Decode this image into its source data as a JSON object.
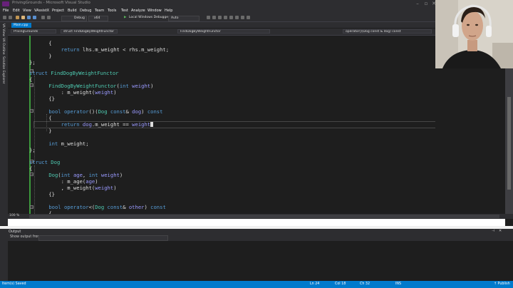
{
  "window": {
    "title": "PrivingGrounds - Microsoft Visual Studio"
  },
  "menu": [
    "File",
    "Edit",
    "View",
    "VAssistX",
    "Project",
    "Build",
    "Debug",
    "Team",
    "Tools",
    "Test",
    "Analyze",
    "Window",
    "Help"
  ],
  "toolbar": {
    "config": "Debug",
    "platform": "x64",
    "debugger": "Local Windows Debugger",
    "auto": "Auto"
  },
  "side_tabs": [
    "VA View",
    "VA Outline",
    "Solution Explorer"
  ],
  "document": {
    "tab": "Main.cpp",
    "nav_project": "PrivingGrounds",
    "nav_scope": "FindDogByWeightFunctor",
    "nav_struct": "struct FindDogByWeightFunctor",
    "nav_member": "FindDogByWeightFunctor",
    "nav_member2": "operator()(Dog const & dog) const"
  },
  "code": [
    "    {",
    "        return lhs.m_weight < rhs.m_weight;",
    "    }",
    "};",
    "",
    "struct FindDogByWeightFunctor",
    "{",
    "    FindDogByWeightFunctor(int weight)",
    "        : m_weight(weight)",
    "    {}",
    "",
    "    bool operator()(Dog const& dog) const",
    "    {",
    "        return dog.m_weight == weight",
    "    }",
    "",
    "    int m_weight;",
    "};",
    "",
    "struct Dog",
    "{",
    "    Dog(int age, int weight)",
    "        : m_age(age)",
    "        , m_weight(weight)",
    "    {}",
    "",
    "    bool operator<(Dog const& other) const",
    "    {"
  ],
  "editor": {
    "zoom": "100 %"
  },
  "output": {
    "title": "Output",
    "show_from": "Show output from:"
  },
  "status": {
    "left": "Item(s) Saved",
    "ln": "Ln 24",
    "col": "Col 18",
    "ch": "Ch 32",
    "ins": "INS",
    "publish": "↑ Publish"
  },
  "colors": {
    "accent": "#007acc",
    "keyword": "#569cd6",
    "type": "#4ec9b0",
    "param": "#9a9aff",
    "bg": "#1e1e1e"
  }
}
